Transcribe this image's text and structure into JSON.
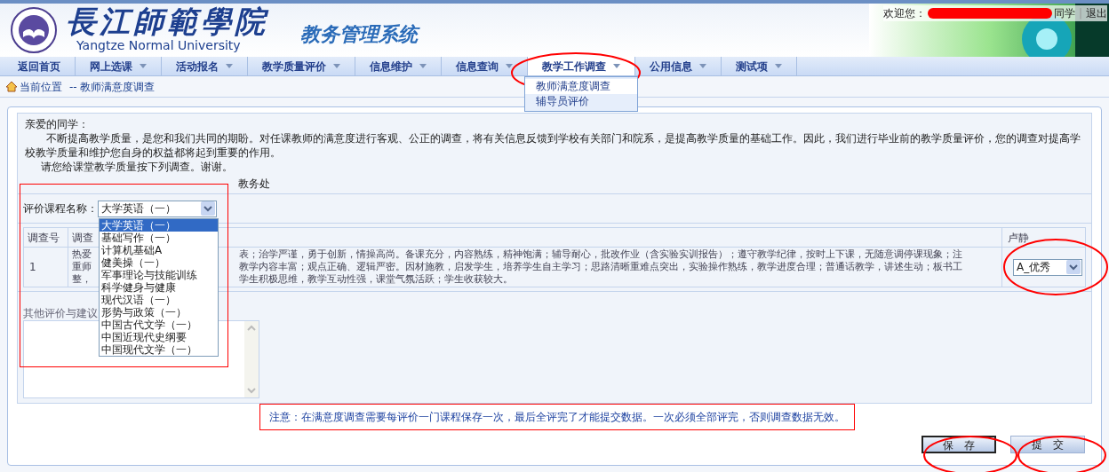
{
  "header": {
    "school_name": "長江師範學院",
    "school_name_en": "Yangtze Normal University",
    "system_title": "教务管理系统",
    "welcome": "欢迎您：",
    "user_suffix": "同学",
    "separator": "|",
    "logout": "退出"
  },
  "nav": [
    {
      "label": "返回首页",
      "has_caret": false,
      "selected": false
    },
    {
      "label": "网上选课",
      "has_caret": true,
      "selected": false
    },
    {
      "label": "活动报名",
      "has_caret": true,
      "selected": false
    },
    {
      "label": "教学质量评价",
      "has_caret": true,
      "selected": false
    },
    {
      "label": "信息维护",
      "has_caret": true,
      "selected": false
    },
    {
      "label": "信息查询",
      "has_caret": true,
      "selected": false
    },
    {
      "label": "教学工作调查",
      "has_caret": true,
      "selected": true
    },
    {
      "label": "公用信息",
      "has_caret": true,
      "selected": false
    },
    {
      "label": "测试项",
      "has_caret": true,
      "selected": false
    }
  ],
  "submenu": [
    {
      "label": "教师满意度调查",
      "selected": true
    },
    {
      "label": "辅导员评价",
      "selected": false
    }
  ],
  "breadcrumb": {
    "label": "当前位置",
    "path": "-- 教师满意度调查"
  },
  "intro": {
    "greeting": "亲爱的同学：",
    "paragraph": "不断提高教学质量，是您和我们共同的期盼。对任课教师的满意度进行客观、公正的调查，将有关信息反馈到学校有关部门和院系，是提高教学质量的基础工作。因此，我们进行毕业前的教学质量评价，您的调查对提高学校教学质量和维护您自身的权益都将起到重要的作用。",
    "request": "请您给课堂教学质量按下列调查。谢谢。",
    "signature": "教务处"
  },
  "course_select": {
    "label": "评价课程名称：",
    "value": "大学英语（一）",
    "options": [
      {
        "label": "大学英语（一）",
        "selected": true
      },
      {
        "label": "基础写作（一）",
        "selected": false
      },
      {
        "label": "计算机基础A",
        "selected": false
      },
      {
        "label": "健美操（一）",
        "selected": false
      },
      {
        "label": "军事理论与技能训练",
        "selected": false
      },
      {
        "label": "科学健身与健康",
        "selected": false
      },
      {
        "label": "现代汉语（一）",
        "selected": false
      },
      {
        "label": "形势与政策（一）",
        "selected": false
      },
      {
        "label": "中国古代文学（一）",
        "selected": false
      },
      {
        "label": "中国近现代史纲要",
        "selected": false
      },
      {
        "label": "中国现代文学（一）",
        "selected": false
      }
    ]
  },
  "table": {
    "columns": [
      "调查号",
      "调查",
      "卢静"
    ],
    "rows": [
      {
        "number": "1",
        "content_lines": [
          {
            "left": "热爱",
            "right": "表；治学严谨，勇于创新，情操高尚。备课充分，内容熟练，精神饱满；辅导耐心，批改作业（含实验实训报告）；遵守教学纪律，按时上下课，无随意调停课现象；注"
          },
          {
            "left": "重师",
            "right": "教学内容丰富；观点正确、逻辑严密。因材施教，启发学生，培养学生自主学习；思路清晰重难点突出，实验操作熟练，教学进度合理；普通话教学，讲述生动；板书工"
          },
          {
            "left": "整，",
            "right": "学生积极思维，教学互动性强，课堂气氛活跃；学生收获较大。"
          }
        ],
        "rating": "A_优秀"
      }
    ]
  },
  "comments": {
    "label": "其他评价与建议"
  },
  "notice": "注意：在满意度调查需要每评价一门课程保存一次，最后全评完了才能提交数据。一次必须全部评完，否则调查数据无效。",
  "buttons": [
    {
      "label": "保　存",
      "focused": true
    },
    {
      "label": "提　交",
      "focused": false
    }
  ]
}
